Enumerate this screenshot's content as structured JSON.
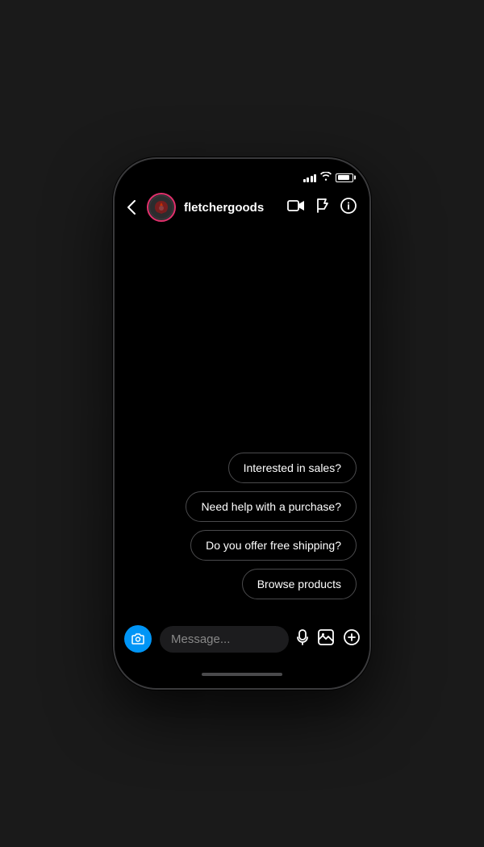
{
  "phone": {
    "status_bar": {
      "signal_label": "signal",
      "wifi_label": "wifi",
      "battery_label": "battery"
    },
    "header": {
      "back_label": "‹",
      "username": "fletchergoods",
      "video_icon_label": "video",
      "flag_icon_label": "flag",
      "info_icon_label": "info"
    },
    "chat": {
      "quick_replies": [
        {
          "id": 1,
          "text": "Interested in sales?"
        },
        {
          "id": 2,
          "text": "Need help with a purchase?"
        },
        {
          "id": 3,
          "text": "Do you offer free shipping?"
        },
        {
          "id": 4,
          "text": "Browse products"
        }
      ]
    },
    "input_bar": {
      "placeholder": "Message...",
      "camera_label": "camera",
      "mic_label": "mic",
      "gallery_label": "gallery",
      "add_label": "add"
    }
  }
}
